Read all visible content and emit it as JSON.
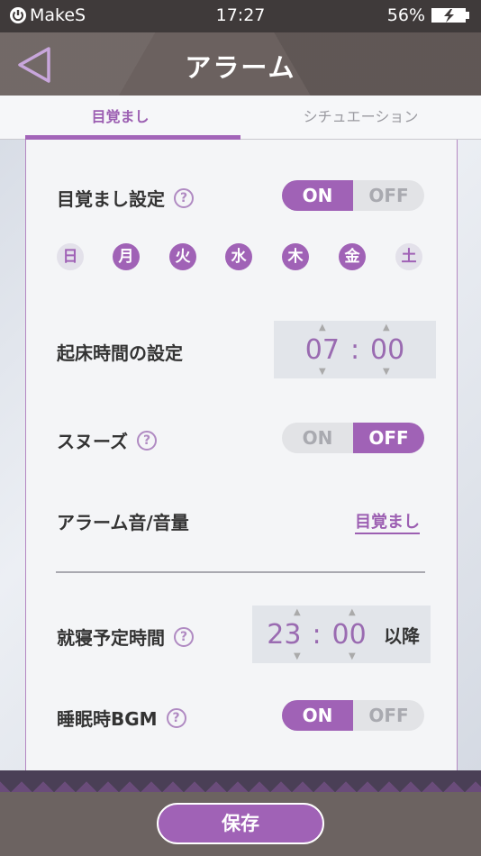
{
  "status_bar": {
    "brand": "MakeS",
    "time": "17:27",
    "battery": "56%"
  },
  "header": {
    "title": "アラーム"
  },
  "tabs": [
    {
      "label": "目覚まし",
      "active": true
    },
    {
      "label": "シチュエーション",
      "active": false
    }
  ],
  "wake": {
    "label": "目覚まし設定",
    "on": "ON",
    "off": "OFF",
    "selected": "ON"
  },
  "days": [
    {
      "label": "日",
      "selected": false
    },
    {
      "label": "月",
      "selected": true
    },
    {
      "label": "火",
      "selected": true
    },
    {
      "label": "水",
      "selected": true
    },
    {
      "label": "木",
      "selected": true
    },
    {
      "label": "金",
      "selected": true
    },
    {
      "label": "土",
      "selected": false
    }
  ],
  "wake_time": {
    "label": "起床時間の設定",
    "hour": "07",
    "minute": "00",
    "sep": ":"
  },
  "snooze": {
    "label": "スヌーズ",
    "on": "ON",
    "off": "OFF",
    "selected": "OFF"
  },
  "alarm_sound": {
    "label": "アラーム音/音量",
    "value": "目覚まし"
  },
  "sleep_time": {
    "label": "就寝予定時間",
    "hour": "23",
    "minute": "00",
    "sep": ":",
    "suffix": "以降"
  },
  "sleep_bgm": {
    "label": "睡眠時BGM",
    "on": "ON",
    "off": "OFF",
    "selected": "ON"
  },
  "footer": {
    "save": "保存"
  },
  "colors": {
    "accent": "#a062b6",
    "header": "#6b615f"
  }
}
